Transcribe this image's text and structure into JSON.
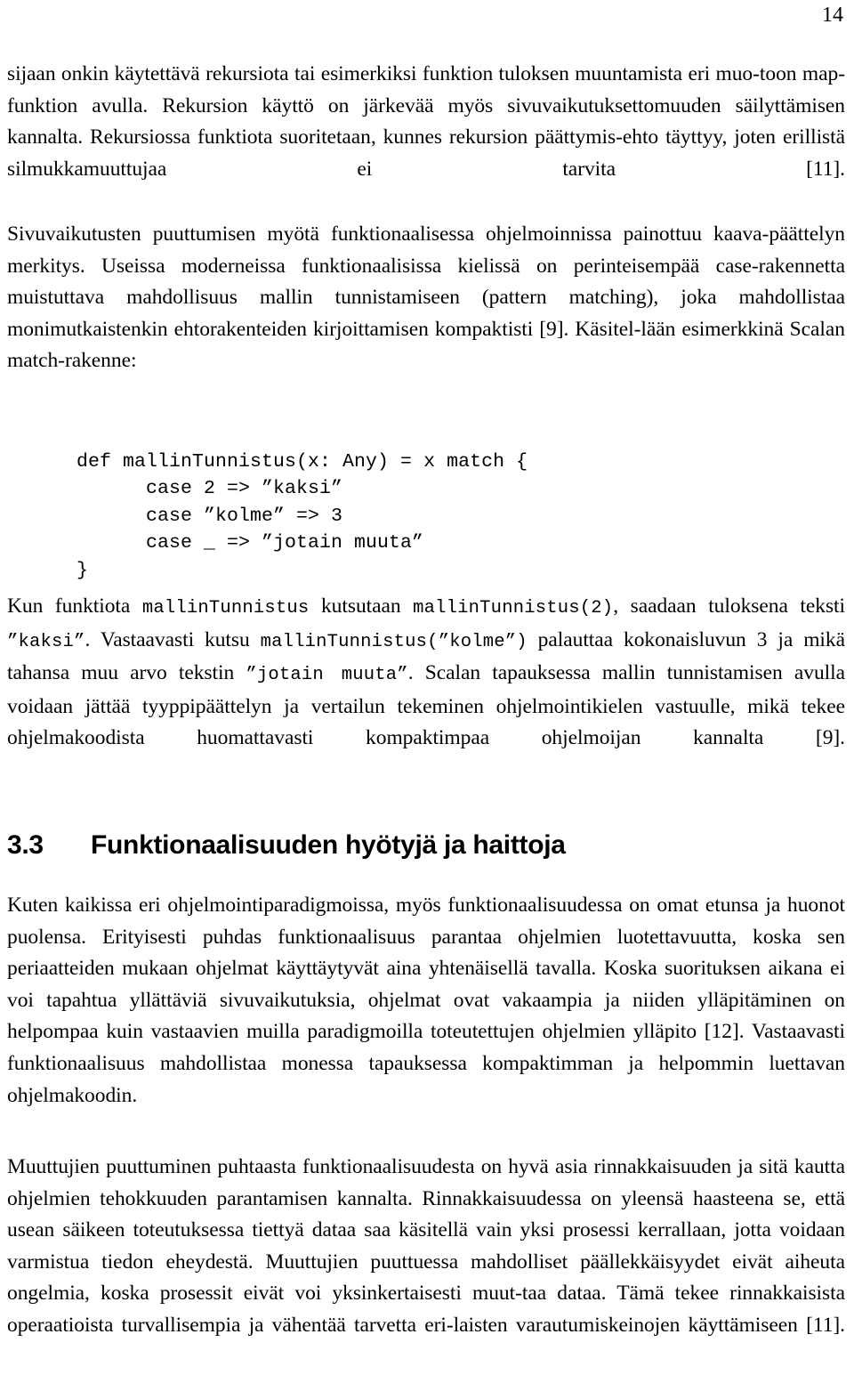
{
  "page": {
    "number": "14",
    "language": "fi"
  },
  "paragraphs": {
    "p1": "sijaan onkin käytettävä rekursiota tai esimerkiksi funktion tuloksen muuntamista eri muo-toon map-funktion avulla. Rekursion käyttö on järkevää myös sivuvaikutuksettomuuden säilyttämisen kannalta. Rekursiossa funktiota suoritetaan, kunnes rekursion päättymis-ehto täyttyy, joten erillistä silmukkamuuttujaa ei tarvita [11].",
    "p2": "Sivuvaikutusten puuttumisen myötä funktionaalisessa ohjelmoinnissa painottuu kaava-päättelyn merkitys. Useissa moderneissa funktionaalisissa kielissä on perinteisempää case-rakennetta muistuttava mahdollisuus mallin tunnistamiseen (pattern matching), joka mahdollistaa monimutkaistenkin ehtorakenteiden kirjoittamisen kompaktisti [9]. Käsitel-lään esimerkkinä Scalan match-rakenne:",
    "p4_after": "on omat etunsa ja huonot puolensa.",
    "p5": "Kuten kaikissa eri ohjelmointiparadigmoissa, myös funktionaalisuudessa on omat etunsa ja huonot puolensa. Erityisesti puhdas funktionaalisuus parantaa ohjelmien luotettavuutta, koska sen periaatteiden mukaan ohjelmat käyttäytyvät aina yhtenäisellä tavalla. Koska suorituksen aikana ei voi tapahtua yllättäviä sivuvaikutuksia, ohjelmat ovat vakaampia ja niiden ylläpitäminen on helpompaa kuin vastaavien muilla paradigmoilla toteutettujen ohjelmien ylläpito [12]. Vastaavasti funktionaalisuus mahdollistaa monessa tapauksessa kompaktimman ja helpommin luettavan ohjelmakoodin.",
    "p6": "Muuttujien puuttuminen puhtaasta funktionaalisuudesta on hyvä asia rinnakkaisuuden ja sitä kautta ohjelmien tehokkuuden parantamisen kannalta. Rinnakkaisuudessa on yleensä haasteena se, että usean säikeen toteutuksessa tiettyä dataa saa käsitellä vain yksi prosessi kerrallaan, jotta voidaan varmistua tiedon eheydestä. Muuttujien puuttuessa mahdolliset päällekkäisyydet eivät aiheuta ongelmia, koska prosessit eivät voi yksinkertaisesti muut-taa dataa. Tämä tekee rinnakkaisista operaatioista turvallisempia ja vähentää tarvetta eri-laisten varautumiskeinojen käyttämiseen [11]."
  },
  "code_block": {
    "language": "scala",
    "lines": [
      "def mallinTunnistus(x: Any) = x match {",
      "      case 2 => ”kaksi”",
      "      case ”kolme” => 3",
      "      case _ => ”jotain muuta”",
      "}"
    ],
    "text": "def mallinTunnistus(x: Any) = x match {\n      case 2 => ”kaksi”\n      case ”kolme” => 3\n      case _ => ”jotain muuta”\n}"
  },
  "explanation_paragraph": {
    "seg1": "Kun funktiota ",
    "code1": "mallinTunnistus",
    "seg2": " kutsutaan ",
    "code2": "mallinTunnistus(2)",
    "seg3": ", saadaan tuloksena teksti ",
    "code3": "”kaksi”",
    "seg4": ". Vastaavasti kutsu ",
    "code4": "mallinTunnistus(”kolme”)",
    "seg5": " palauttaa kokonaisluvun 3 ja mikä tahansa muu arvo tekstin ",
    "code5": "”jotain muuta”",
    "seg6": ". Scalan tapauksessa mallin tunnistamisen avulla voidaan jättää tyyppipäättelyn ja vertailun tekeminen ohjelmointikielen vastuulle, mikä tekee ohjelmakoodista huomattavasti kompaktimpaa ohjelmoijan kannalta [9]."
  },
  "heading": {
    "number": "3.3",
    "title": "Funktionaalisuuden hyötyjä ja haittoja"
  },
  "colors": {
    "text": "#000000",
    "background": "#ffffff"
  }
}
